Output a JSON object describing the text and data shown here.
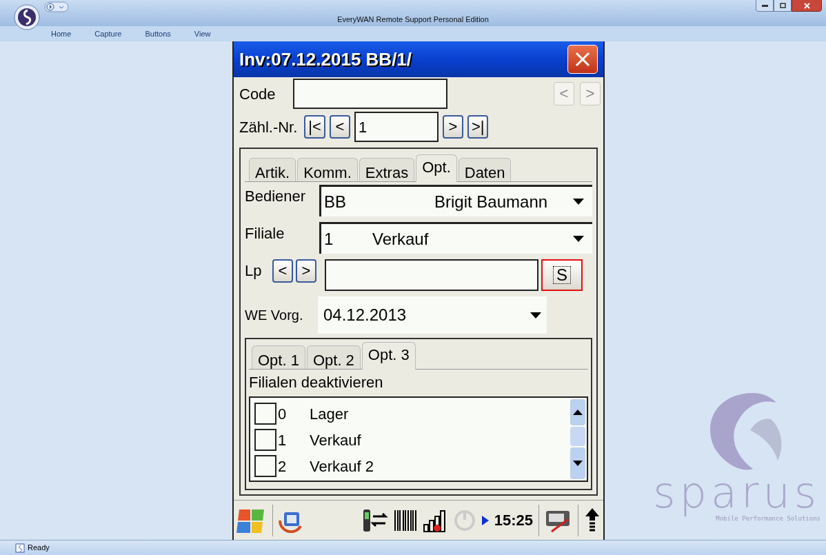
{
  "window": {
    "title": "EveryWAN Remote Support Personal Edition"
  },
  "menu": [
    "Home",
    "Capture",
    "Buttons",
    "View"
  ],
  "device": {
    "title": "Inv:07.12.2015 BB/1/",
    "code": {
      "label": "Code"
    },
    "record_arrows": [
      {
        "label": "<",
        "disabled": true
      },
      {
        "label": ">",
        "disabled": true
      }
    ],
    "counter": {
      "label": "Zähl.-Nr.",
      "first": "|<",
      "prev": "<",
      "value": "1",
      "next": ">",
      "last": ">|"
    },
    "tabs": [
      {
        "label": "Artik.",
        "selected": false
      },
      {
        "label": "Komm.",
        "selected": false
      },
      {
        "label": "Extras",
        "selected": false
      },
      {
        "label": "Opt.",
        "selected": true
      },
      {
        "label": "Daten",
        "selected": false
      }
    ],
    "bediener": {
      "label": "Bediener",
      "code": "BB",
      "name": "Brigit Baumann"
    },
    "filiale": {
      "label": "Filiale",
      "code": "1",
      "name": "Verkauf"
    },
    "lp": {
      "label": "Lp",
      "prev": "<",
      "next": ">",
      "search": "S",
      "focused": true
    },
    "we_vorg": {
      "label": "WE Vorg.",
      "value": "04.12.2013"
    },
    "subtabs": [
      {
        "label": "Opt. 1",
        "selected": false
      },
      {
        "label": "Opt. 2",
        "selected": false
      },
      {
        "label": "Opt. 3",
        "selected": true
      }
    ],
    "group_label": "Filialen deaktivieren",
    "branches": [
      {
        "number": "0",
        "name": "Lager",
        "checked": false
      },
      {
        "number": "1",
        "name": "Verkauf",
        "checked": false
      },
      {
        "number": "2",
        "name": "Verkauf 2",
        "checked": false
      }
    ],
    "clock": "15:25"
  },
  "logo": {
    "name": "sparus",
    "tagline": "Mobile Performance Solutions"
  },
  "status_bar": {
    "text": "Ready"
  }
}
